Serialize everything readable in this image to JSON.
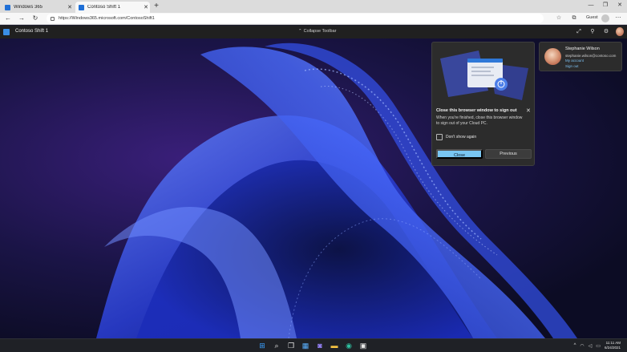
{
  "browser": {
    "tabs": [
      {
        "label": "Windows 365",
        "active": false
      },
      {
        "label": "Contoso Shift 1",
        "active": true
      }
    ],
    "new_tab_glyph": "+",
    "url": "https://Windows365.microsoft.com/ContosoShift1",
    "profile_label": "Guest",
    "window_controls": [
      "—",
      "❐",
      "✕"
    ]
  },
  "cloudpc_bar": {
    "title": "Contoso Shift 1",
    "collapse_label": "Collapse Toolbar",
    "icons": [
      "fullscreen-icon",
      "pin-icon",
      "settings-icon",
      "avatar"
    ]
  },
  "signout_flyout": {
    "heading": "Close this browser window to sign out",
    "body": "When you're finished, close this browser window to sign out of your Cloud PC.",
    "checkbox_label": "Don't show again",
    "checkbox_checked": false,
    "primary_button": "Close",
    "secondary_button": "Previous",
    "accent_color": "#79c6f2"
  },
  "account": {
    "name": "Stephanie Wilson",
    "email": "stephanie.wilson@contoso.com",
    "my_account_link": "My account",
    "sign_out_link": "Sign out"
  },
  "taskbar": {
    "icons": [
      "windows-start-icon",
      "search-icon",
      "task-view-icon",
      "widgets-icon",
      "teams-chat-icon",
      "file-explorer-icon",
      "edge-icon",
      "store-icon"
    ],
    "tray_chevron": "^",
    "time": "11:11 AM",
    "date": "6/24/2021"
  }
}
